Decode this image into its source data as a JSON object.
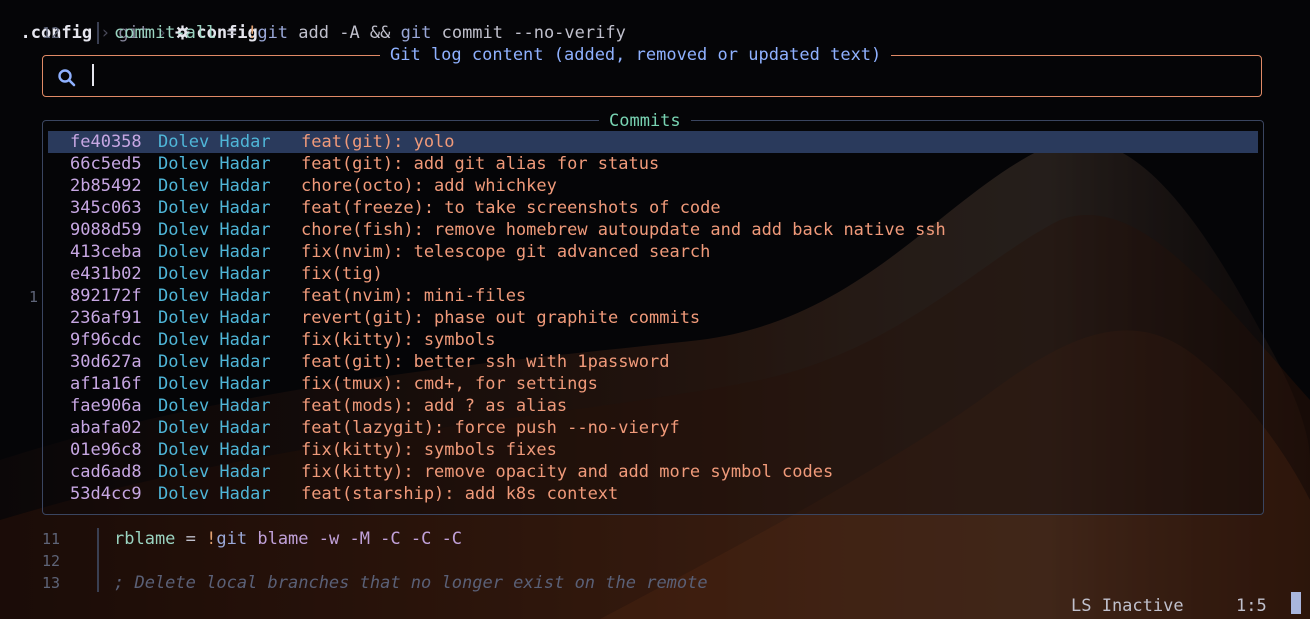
{
  "breadcrumb": {
    "root": ".config",
    "parent": "git",
    "current": "config"
  },
  "editor_top": {
    "line_number": "12",
    "code": {
      "key": "commit-all",
      "eq": " = ",
      "bang": "!",
      "cmd": "git",
      "rest": " add -A && ",
      "cmd2": "git",
      "rest2": " commit --no-verify"
    }
  },
  "search": {
    "title": "Git log content (added, removed or updated text)",
    "value": ""
  },
  "commits": {
    "title": "Commits",
    "side_number": "1",
    "rows": [
      {
        "hash": "fe40358",
        "author": "Dolev Hadar",
        "message": "feat(git): yolo"
      },
      {
        "hash": "66c5ed5",
        "author": "Dolev Hadar",
        "message": "feat(git): add git alias for status"
      },
      {
        "hash": "2b85492",
        "author": "Dolev Hadar",
        "message": "chore(octo): add whichkey"
      },
      {
        "hash": "345c063",
        "author": "Dolev Hadar",
        "message": "feat(freeze): to take screenshots of code"
      },
      {
        "hash": "9088d59",
        "author": "Dolev Hadar",
        "message": "chore(fish): remove homebrew autoupdate and add back native ssh"
      },
      {
        "hash": "413ceba",
        "author": "Dolev Hadar",
        "message": "fix(nvim): telescope git advanced search"
      },
      {
        "hash": "e431b02",
        "author": "Dolev Hadar",
        "message": "fix(tig)"
      },
      {
        "hash": "892172f",
        "author": "Dolev Hadar",
        "message": "feat(nvim): mini-files"
      },
      {
        "hash": "236af91",
        "author": "Dolev Hadar",
        "message": "revert(git): phase out graphite commits"
      },
      {
        "hash": "9f96cdc",
        "author": "Dolev Hadar",
        "message": "fix(kitty): symbols"
      },
      {
        "hash": "30d627a",
        "author": "Dolev Hadar",
        "message": "feat(git): better ssh with 1password"
      },
      {
        "hash": "af1a16f",
        "author": "Dolev Hadar",
        "message": "fix(tmux): cmd+, for settings"
      },
      {
        "hash": "fae906a",
        "author": "Dolev Hadar",
        "message": "feat(mods): add ? as alias"
      },
      {
        "hash": "abafa02",
        "author": "Dolev Hadar",
        "message": "feat(lazygit): force push --no-vieryf"
      },
      {
        "hash": "01e96c8",
        "author": "Dolev Hadar",
        "message": "fix(kitty): symbols fixes"
      },
      {
        "hash": "cad6ad8",
        "author": "Dolev Hadar",
        "message": "fix(kitty): remove opacity and add more symbol codes"
      },
      {
        "hash": "53d4cc9",
        "author": "Dolev Hadar",
        "message": "feat(starship): add k8s context"
      }
    ]
  },
  "editor_bottom": [
    {
      "line_number": "11",
      "key": "rblame",
      "eq": " = ",
      "bang": "!",
      "cmd": "git",
      "rest": " blame -w -M -C -C -C"
    },
    {
      "line_number": "12"
    },
    {
      "line_number": "13",
      "comment": "; Delete local branches that no longer exist on the remote"
    }
  ],
  "statusline": {
    "lsp": "LS Inactive",
    "position": "1:5"
  },
  "icons": [
    "gear-icon",
    "search-icon",
    "chevron-right-icon"
  ]
}
